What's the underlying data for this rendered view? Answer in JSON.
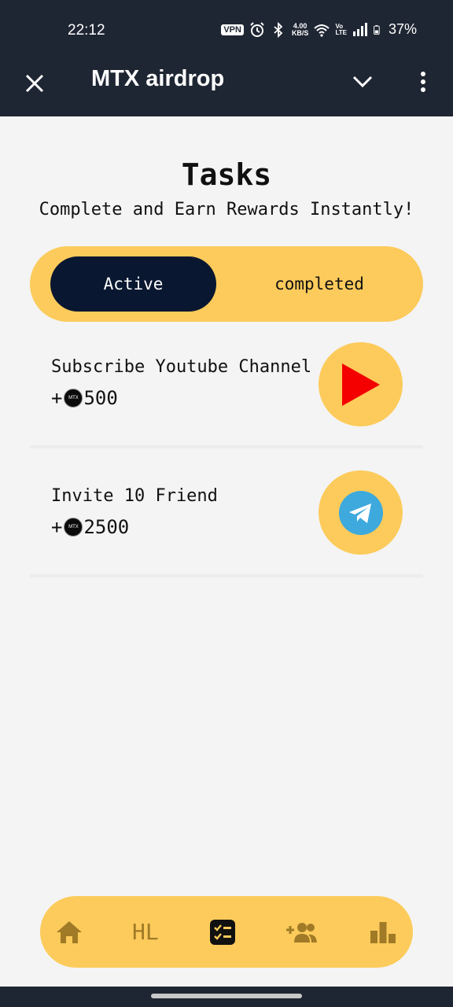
{
  "status_bar": {
    "time": "22:12",
    "vpn": "VPN",
    "speed_value": "4.00",
    "speed_unit": "KB/S",
    "volte_top": "Vo",
    "volte_bottom": "LTE",
    "battery": "37%",
    "icons": [
      "alarm-icon",
      "bluetooth-icon",
      "wifi-icon",
      "signal-icon",
      "battery-icon"
    ]
  },
  "app_bar": {
    "title": "MTX airdrop",
    "icons": [
      "close-icon",
      "chevron-down-icon",
      "more-vert-icon"
    ]
  },
  "header": {
    "title": "Tasks",
    "subtitle": "Complete and Earn Rewards Instantly!"
  },
  "tabs": {
    "active_label": "Active",
    "completed_label": "completed",
    "selected": "Active"
  },
  "tasks": [
    {
      "title": "Subscribe Youtube Channel",
      "reward_prefix": "+",
      "coin_label": "MTX",
      "reward": "500",
      "icon": "youtube-play-icon"
    },
    {
      "title": "Invite 10 Friend",
      "reward_prefix": "+",
      "coin_label": "MTX",
      "reward": "2500",
      "icon": "telegram-icon"
    }
  ],
  "bottom_nav": {
    "items": [
      "home-icon",
      "hl-logo-icon",
      "tasks-checklist-icon",
      "add-friends-icon",
      "leaderboard-icon"
    ],
    "hl_text": "HL",
    "active": "tasks-checklist-icon"
  },
  "colors": {
    "header_bg": "#1f2633",
    "accent_yellow": "#fccb5b",
    "active_tab": "#0a1731",
    "youtube_red": "#f50000",
    "telegram_blue": "#3ea9dd",
    "nav_icon": "#a07a27"
  }
}
